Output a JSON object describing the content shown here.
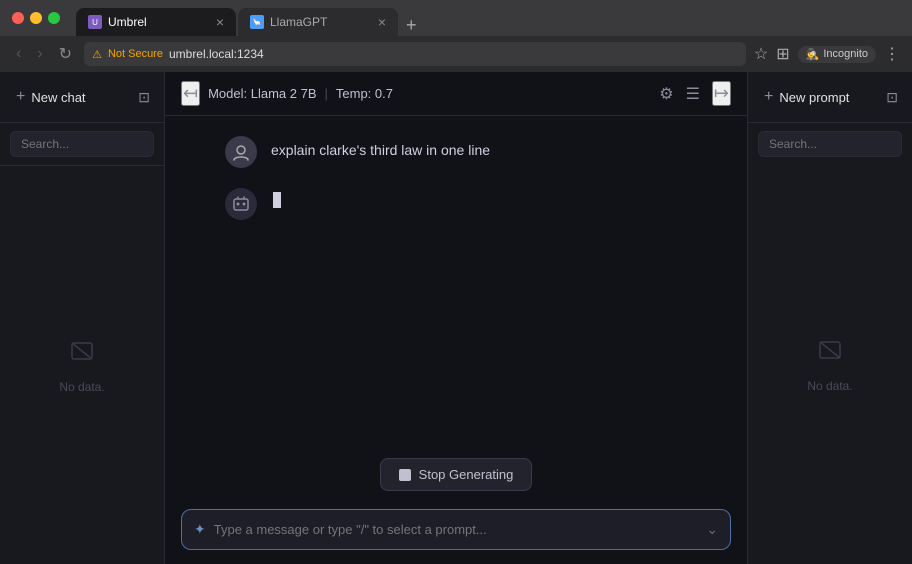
{
  "browser": {
    "tabs": [
      {
        "label": "Umbrel",
        "favicon": "U",
        "favicon_color": "#7c5cbf",
        "active": true
      },
      {
        "label": "LlamaGPT",
        "favicon": "🦙",
        "favicon_color": "#4a9eff",
        "active": false
      }
    ],
    "address": "umbrel.local:1234",
    "security_label": "Not Secure",
    "incognito_label": "Incognito"
  },
  "sidebar_left": {
    "new_chat_label": "New chat",
    "search_placeholder": "Search...",
    "no_data_label": "No data."
  },
  "chat_header": {
    "model_label": "Model: Llama 2 7B",
    "separator": "|",
    "temp_label": "Temp: 0.7"
  },
  "messages": [
    {
      "role": "user",
      "avatar": "👤",
      "content": "explain clarke's third law in one line"
    },
    {
      "role": "ai",
      "avatar": "🤖",
      "content": "",
      "typing": true
    }
  ],
  "stop_btn": {
    "label": "Stop Generating"
  },
  "input": {
    "placeholder": "Type a message or type \"/\" to select a prompt..."
  },
  "sidebar_right": {
    "new_prompt_label": "New prompt",
    "search_placeholder": "Search...",
    "no_data_label": "No data."
  }
}
